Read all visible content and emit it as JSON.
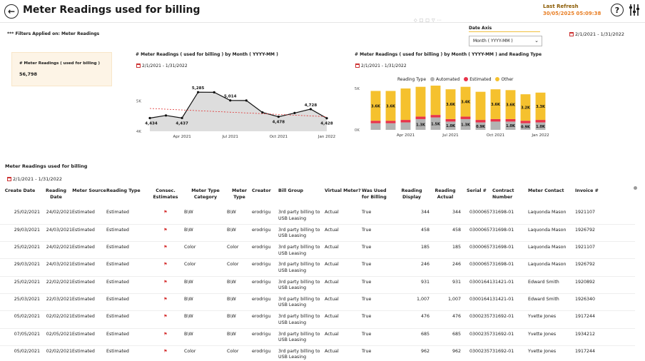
{
  "header": {
    "title": "Meter Readings used for billing",
    "last_refresh_label": "Last Refresh",
    "last_refresh_value": "30/05/2025 05:09:38",
    "help_glyph": "?"
  },
  "filters_text": "*** Filters Applied on: Meter Readings",
  "date_axis": {
    "label": "Date Axis",
    "selected": "Month ( YYYY-MM )"
  },
  "date_range": "2/1/2021 - 1/31/2022",
  "kpi": {
    "label": "# Meter Readings ( used for billing )",
    "value": "56,798"
  },
  "line_chart": {
    "title": "# Meter Readings ( used for billing ) by Month ( YYYY-MM )",
    "date": "2/1/2021 - 1/31/2022"
  },
  "bar_chart": {
    "title": "# Meter Readings ( used for billing ) by Month ( YYYY-MM ) and Reading Type",
    "date": "2/1/2021 - 1/31/2022",
    "legend_title": "Reading Type",
    "colors": {
      "Automated": "#b3b3b3",
      "Estimated": "#e8334a",
      "Other": "#f5c12e"
    }
  },
  "chart_data": [
    {
      "type": "line",
      "x": [
        "2021-02",
        "2021-03",
        "2021-04",
        "2021-05",
        "2021-06",
        "2021-07",
        "2021-08",
        "2021-09",
        "2021-10",
        "2021-11",
        "2021-12",
        "2022-01"
      ],
      "values": [
        4434,
        4520,
        4437,
        5285,
        5280,
        5014,
        5010,
        4620,
        4478,
        4600,
        4728,
        4428
      ],
      "data_labels": [
        {
          "index": 0,
          "text": "4,434"
        },
        {
          "index": 2,
          "text": "4,437"
        },
        {
          "index": 3,
          "text": "5,285"
        },
        {
          "index": 5,
          "text": "5,014"
        },
        {
          "index": 8,
          "text": "4,478"
        },
        {
          "index": 10,
          "text": "4,728"
        },
        {
          "index": 11,
          "text": "4,428"
        }
      ],
      "y_ticks": [
        "5K",
        "4K"
      ],
      "x_ticks": [
        "Apr 2021",
        "Jul 2021",
        "Oct 2021",
        "Jan 2022"
      ],
      "ylim": [
        4000,
        5500
      ],
      "trend": [
        4750,
        4480
      ]
    },
    {
      "type": "bar",
      "x": [
        "2021-02",
        "2021-03",
        "2021-04",
        "2021-05",
        "2021-06",
        "2021-07",
        "2021-08",
        "2021-09",
        "2021-10",
        "2021-11",
        "2021-12",
        "2022-01"
      ],
      "series": [
        {
          "name": "Automated",
          "values": [
            800,
            800,
            900,
            1300,
            1500,
            1000,
            1300,
            900,
            1000,
            1000,
            800,
            900
          ]
        },
        {
          "name": "Estimated",
          "values": [
            300,
            300,
            300,
            300,
            300,
            300,
            300,
            300,
            300,
            300,
            300,
            300
          ]
        },
        {
          "name": "Other",
          "values": [
            3600,
            3600,
            3800,
            3600,
            3700,
            3600,
            3600,
            3400,
            3600,
            3500,
            3200,
            3300
          ]
        }
      ],
      "data_labels": [
        {
          "index": 0,
          "series": "Other",
          "text": "3.6K"
        },
        {
          "index": 1,
          "series": "Other",
          "text": "3.6K"
        },
        {
          "index": 3,
          "series": "Automated",
          "text": "1.3K"
        },
        {
          "index": 4,
          "series": "Automated",
          "text": "1.5K"
        },
        {
          "index": 5,
          "series": "Other",
          "text": "3.6K"
        },
        {
          "index": 5,
          "series": "Automated",
          "text": "1.0K"
        },
        {
          "index": 6,
          "series": "Other",
          "text": "3.4K"
        },
        {
          "index": 6,
          "series": "Automated",
          "text": "1.3K"
        },
        {
          "index": 7,
          "series": "Automated",
          "text": "0.9K"
        },
        {
          "index": 8,
          "series": "Other",
          "text": "3.6K"
        },
        {
          "index": 9,
          "series": "Other",
          "text": "3.6K"
        },
        {
          "index": 9,
          "series": "Automated",
          "text": "1.0K"
        },
        {
          "index": 10,
          "series": "Automated",
          "text": "0.9K"
        },
        {
          "index": 10,
          "series": "Other",
          "text": "3.2K"
        },
        {
          "index": 11,
          "series": "Other",
          "text": "3.3K"
        },
        {
          "index": 11,
          "series": "Automated",
          "text": "1.0K"
        }
      ],
      "y_ticks": [
        "5K",
        "0K"
      ],
      "x_ticks": [
        "Apr 2021",
        "Jul 2021",
        "Oct 2021",
        "Jan 2022"
      ],
      "ylim": [
        0,
        5000
      ]
    }
  ],
  "table": {
    "title": "Meter Readings used for billing",
    "date": "2/1/2021 - 1/31/2022",
    "columns": [
      "Create Date",
      "Reading Date",
      "Meter Source",
      "Reading Type",
      "Consec. Estimates",
      "Meter Type Category",
      "Meter Type",
      "Creator",
      "Bill Group",
      "Virtual Meter?",
      "Was Used for Billing",
      "Reading Display",
      "Reading Actual",
      "Serial #",
      "Contract Number",
      "Meter Contact",
      "Invoice #"
    ],
    "rows": [
      [
        "25/02/2021",
        "24/02/2021",
        "Estimated",
        "Estimated",
        "B\\W",
        "B\\W",
        "erodrigu",
        "3rd party billing to USB Leasing",
        "Actual",
        "True",
        "344",
        "344",
        "03000657",
        "31698-01",
        "Laquonda Mason",
        "1921107"
      ],
      [
        "29/03/2021",
        "24/03/2021",
        "Estimated",
        "Estimated",
        "B\\W",
        "B\\W",
        "erodrigu",
        "3rd party billing to USB Leasing",
        "Actual",
        "True",
        "458",
        "458",
        "03000657",
        "31698-01",
        "Laquonda Mason",
        "1926792"
      ],
      [
        "25/02/2021",
        "24/02/2021",
        "Estimated",
        "Estimated",
        "Color",
        "Color",
        "erodrigu",
        "3rd party billing to USB Leasing",
        "Actual",
        "True",
        "185",
        "185",
        "03000657",
        "31698-01",
        "Laquonda Mason",
        "1921107"
      ],
      [
        "29/03/2021",
        "24/03/2021",
        "Estimated",
        "Estimated",
        "Color",
        "Color",
        "erodrigu",
        "3rd party billing to USB Leasing",
        "Actual",
        "True",
        "246",
        "246",
        "03000657",
        "31698-01",
        "Laquonda Mason",
        "1926792"
      ],
      [
        "25/02/2021",
        "22/02/2021",
        "Estimated",
        "Estimated",
        "B\\W",
        "B\\W",
        "erodrigu",
        "3rd party billing to USB Leasing",
        "Actual",
        "True",
        "931",
        "931",
        "03001641",
        "31421-01",
        "Edward Smith",
        "1920892"
      ],
      [
        "25/03/2021",
        "22/03/2021",
        "Estimated",
        "Estimated",
        "B\\W",
        "B\\W",
        "erodrigu",
        "3rd party billing to USB Leasing",
        "Actual",
        "True",
        "1,007",
        "1,007",
        "03001641",
        "31421-01",
        "Edward Smith",
        "1926340"
      ],
      [
        "05/02/2021",
        "02/02/2021",
        "Estimated",
        "Estimated",
        "B\\W",
        "B\\W",
        "erodrigu",
        "3rd party billing to USB Leasing",
        "Actual",
        "True",
        "476",
        "476",
        "03002357",
        "31692-01",
        "Yvette Jones",
        "1917244"
      ],
      [
        "07/05/2021",
        "02/05/2021",
        "Estimated",
        "Estimated",
        "B\\W",
        "B\\W",
        "erodrigu",
        "3rd party billing to USB Leasing",
        "Actual",
        "True",
        "685",
        "685",
        "03002357",
        "31692-01",
        "Yvette Jones",
        "1934212"
      ],
      [
        "05/02/2021",
        "02/02/2021",
        "Estimated",
        "Estimated",
        "Color",
        "Color",
        "erodrigu",
        "3rd party billing to USB Leasing",
        "Actual",
        "True",
        "962",
        "962",
        "03002357",
        "31692-01",
        "Yvette Jones",
        "1917244"
      ]
    ]
  }
}
